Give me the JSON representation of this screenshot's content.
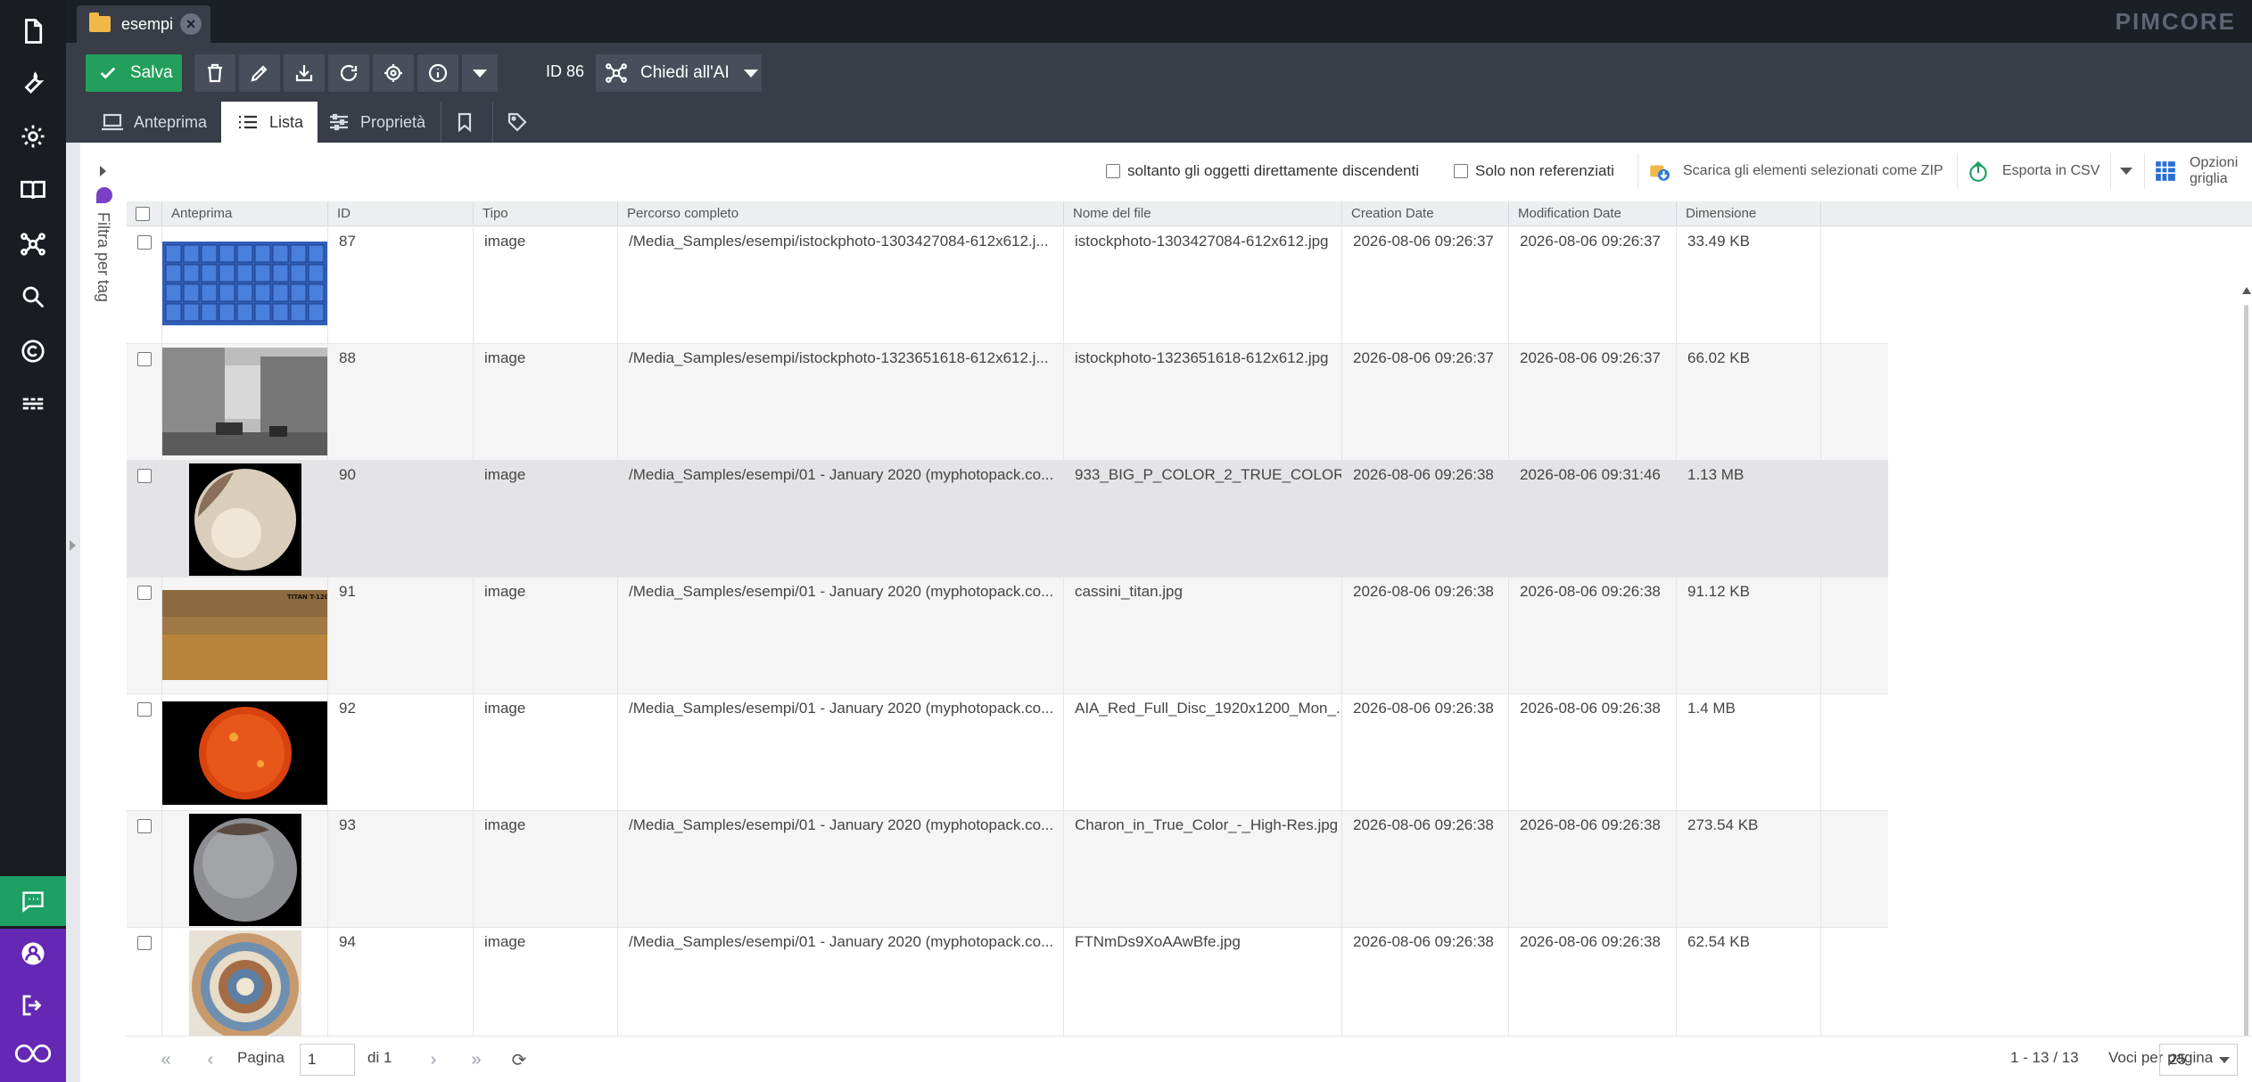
{
  "nav": {
    "icons": [
      "file-icon",
      "wrench-icon",
      "gear-icon",
      "book-icon",
      "ai-hub-icon",
      "search-icon",
      "copyright-icon",
      "ecommerce-icon"
    ],
    "bottom": [
      "chat-icon",
      "user-icon",
      "logout-icon",
      "pimcore-logo-icon"
    ]
  },
  "topbar": {
    "tab_title": "esempi",
    "brand": "PIMCORE"
  },
  "toolbar": {
    "save_label": "Salva",
    "id_label": "ID 86",
    "ai_label": "Chiedi all'AI"
  },
  "subtabs": {
    "preview": "Anteprima",
    "list": "Lista",
    "properties": "Proprietà"
  },
  "tagpanel": {
    "label": "Filtra per tag"
  },
  "filters": {
    "only_direct": "soltanto gli oggetti direttamente discendenti",
    "only_unreferenced": "Solo non referenziati",
    "download_zip": "Scarica gli elementi selezionati come ZIP",
    "export_csv": "Esporta in CSV",
    "grid_options": "Opzioni griglia"
  },
  "grid": {
    "columns": [
      "Anteprima",
      "ID",
      "Tipo",
      "Percorso completo",
      "Nome del file",
      "Creation Date",
      "Modification Date",
      "Dimensione"
    ],
    "rows": [
      {
        "id": "87",
        "type": "image",
        "path": "/Media_Samples/esempi/istockphoto-1303427084-612x612.j...",
        "filename": "istockphoto-1303427084-612x612.jpg",
        "created": "2026-08-06 09:26:37",
        "modified": "2026-08-06 09:26:37",
        "size": "33.49 KB",
        "thumb": "blue-lockers"
      },
      {
        "id": "88",
        "type": "image",
        "path": "/Media_Samples/esempi/istockphoto-1323651618-612x612.j...",
        "filename": "istockphoto-1323651618-612x612.jpg",
        "created": "2026-08-06 09:26:37",
        "modified": "2026-08-06 09:26:37",
        "size": "66.02 KB",
        "thumb": "old-street"
      },
      {
        "id": "90",
        "type": "image",
        "path": "/Media_Samples/esempi/01 - January 2020 (myphotopack.co...",
        "filename": "933_BIG_P_COLOR_2_TRUE_COLOR...",
        "created": "2026-08-06 09:26:38",
        "modified": "2026-08-06 09:31:46",
        "size": "1.13 MB",
        "thumb": "pluto"
      },
      {
        "id": "91",
        "type": "image",
        "path": "/Media_Samples/esempi/01 - January 2020 (myphotopack.co...",
        "filename": "cassini_titan.jpg",
        "created": "2026-08-06 09:26:38",
        "modified": "2026-08-06 09:26:38",
        "size": "91.12 KB",
        "thumb": "titan",
        "thumb_caption": "TITAN T-120"
      },
      {
        "id": "92",
        "type": "image",
        "path": "/Media_Samples/esempi/01 - January 2020 (myphotopack.co...",
        "filename": "AIA_Red_Full_Disc_1920x1200_Mon_...",
        "created": "2026-08-06 09:26:38",
        "modified": "2026-08-06 09:26:38",
        "size": "1.4 MB",
        "thumb": "sun"
      },
      {
        "id": "93",
        "type": "image",
        "path": "/Media_Samples/esempi/01 - January 2020 (myphotopack.co...",
        "filename": "Charon_in_True_Color_-_High-Res.jpg",
        "created": "2026-08-06 09:26:38",
        "modified": "2026-08-06 09:26:38",
        "size": "273.54 KB",
        "thumb": "charon"
      },
      {
        "id": "94",
        "type": "image",
        "path": "/Media_Samples/esempi/01 - January 2020 (myphotopack.co...",
        "filename": "FTNmDs9XoAAwBfe.jpg",
        "created": "2026-08-06 09:26:38",
        "modified": "2026-08-06 09:26:38",
        "size": "62.54 KB",
        "thumb": "rings"
      }
    ]
  },
  "pager": {
    "page_label": "Pagina",
    "page_value": "1",
    "of_label": "di 1",
    "count": "1 - 13 / 13",
    "per_page_label": "Voci per pagina",
    "per_page_value": "25"
  },
  "colors": {
    "save": "#22a05b",
    "toolbar": "#383d47",
    "nav": "#191c21",
    "accent_purple": "#6428b4",
    "chat_green": "#1ea064"
  }
}
